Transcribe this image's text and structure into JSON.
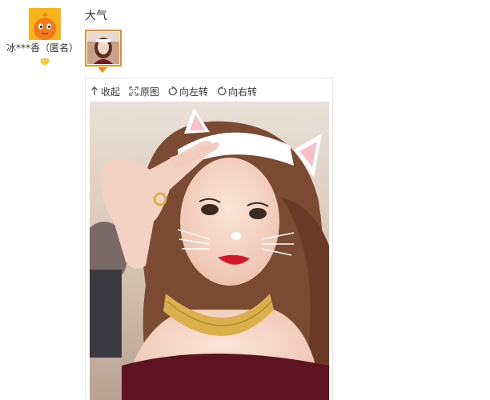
{
  "user": {
    "name": "冰***香（匿名）",
    "avatar_icon": "mascot-avatar-icon",
    "badge_icon": "diamond-vip-icon",
    "badge_color": "#f6b400"
  },
  "comment": {
    "text": "大气"
  },
  "viewer": {
    "accent": "#f08a24",
    "tools": [
      {
        "label": "收起",
        "icon": "collapse-icon"
      },
      {
        "label": "原图",
        "icon": "fullsize-icon"
      },
      {
        "label": "向左转",
        "icon": "rotate-left-icon"
      },
      {
        "label": "向右转",
        "icon": "rotate-right-icon"
      }
    ]
  }
}
